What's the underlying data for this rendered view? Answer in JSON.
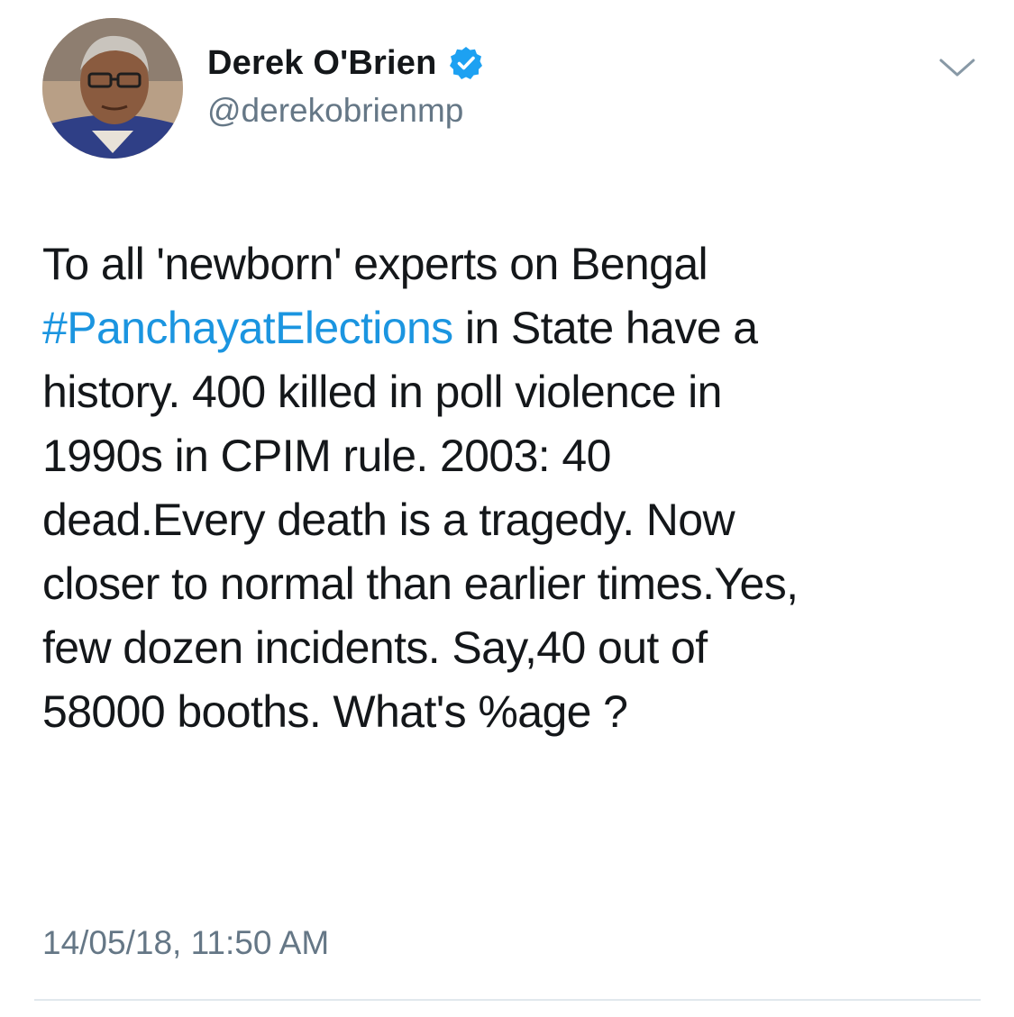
{
  "author": {
    "display_name": "Derek O'Brien",
    "handle": "@derekobrienmp",
    "verified": true,
    "avatar_icon": "profile-photo"
  },
  "menu": {
    "icon": "chevron-down-icon"
  },
  "tweet": {
    "line1": "To all 'newborn' experts on Bengal",
    "hashtag": "#PanchayatElections",
    "line2_rest": " in State have a",
    "line3": "history. 400 killed in poll violence in",
    "line4": "1990s in CPIM rule. 2003: 40",
    "line5": "dead.Every death is a tragedy. Now",
    "line6": "closer to normal than earlier times.Yes,",
    "line7": "few dozen incidents. Say,40 out of",
    "line8": "58000 booths. What's %age ?"
  },
  "timestamp": "14/05/18, 11:50 AM",
  "colors": {
    "hashtag": "#1b95e0",
    "verified_badge": "#1da1f2",
    "secondary_text": "#657786",
    "primary_text": "#14171a"
  }
}
